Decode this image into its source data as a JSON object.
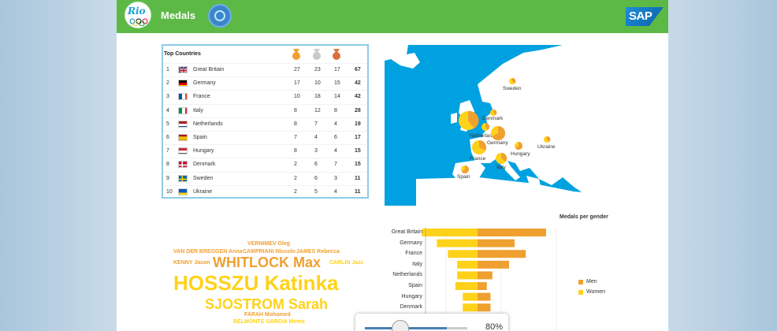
{
  "header": {
    "logo_text": "Rio",
    "title": "Medals",
    "brand": "SAP"
  },
  "table": {
    "title": "Top Countries",
    "medal_icons": [
      "gold-medal-icon",
      "silver-medal-icon",
      "bronze-medal-icon"
    ],
    "rows": [
      {
        "rank": "1",
        "country": "Great Britain",
        "flag": "uk-flag-icon",
        "gold": "27",
        "silver": "23",
        "bronze": "17",
        "total": "67"
      },
      {
        "rank": "2",
        "country": "Germany",
        "flag": "germany-flag-icon",
        "gold": "17",
        "silver": "10",
        "bronze": "15",
        "total": "42"
      },
      {
        "rank": "3",
        "country": "France",
        "flag": "france-flag-icon",
        "gold": "10",
        "silver": "18",
        "bronze": "14",
        "total": "42"
      },
      {
        "rank": "4",
        "country": "Italy",
        "flag": "italy-flag-icon",
        "gold": "8",
        "silver": "12",
        "bronze": "8",
        "total": "28"
      },
      {
        "rank": "5",
        "country": "Netherlands",
        "flag": "netherlands-flag-icon",
        "gold": "8",
        "silver": "7",
        "bronze": "4",
        "total": "19"
      },
      {
        "rank": "6",
        "country": "Spain",
        "flag": "spain-flag-icon",
        "gold": "7",
        "silver": "4",
        "bronze": "6",
        "total": "17"
      },
      {
        "rank": "7",
        "country": "Hungary",
        "flag": "hungary-flag-icon",
        "gold": "8",
        "silver": "3",
        "bronze": "4",
        "total": "15"
      },
      {
        "rank": "8",
        "country": "Denmark",
        "flag": "denmark-flag-icon",
        "gold": "2",
        "silver": "6",
        "bronze": "7",
        "total": "15"
      },
      {
        "rank": "9",
        "country": "Sweden",
        "flag": "sweden-flag-icon",
        "gold": "2",
        "silver": "6",
        "bronze": "3",
        "total": "11"
      },
      {
        "rank": "10",
        "country": "Ukraine",
        "flag": "ukraine-flag-icon",
        "gold": "2",
        "silver": "5",
        "bronze": "4",
        "total": "11"
      }
    ]
  },
  "map": {
    "labels": [
      "Sweden",
      "Denmark",
      "Netherlands",
      "Germany",
      "Ukraine",
      "Hungary",
      "France",
      "Italy",
      "Spain"
    ]
  },
  "word_cloud": [
    {
      "text": "VERNIMEV Oleg",
      "color": "#f0a030"
    },
    {
      "text": "VAN DER BREGGEN Anna",
      "color": "#f0a030"
    },
    {
      "text": "CAMPRIANI Niccolo",
      "color": "#f0a030"
    },
    {
      "text": "JAMES Rebecca",
      "color": "#f0a030"
    },
    {
      "text": "KENNY Jason",
      "color": "#f0a030"
    },
    {
      "text": "WHITLOCK Max",
      "color": "#f0a030"
    },
    {
      "text": "CARLIN Jazz",
      "color": "#ffd21a"
    },
    {
      "text": "HOSSZU Katinka",
      "color": "#ffd21a"
    },
    {
      "text": "SJOSTROM Sarah",
      "color": "#ffd21a"
    },
    {
      "text": "FARAH Mohamed",
      "color": "#f0a030"
    },
    {
      "text": "BELMONTE GARCIA Mireia",
      "color": "#ffd21a"
    }
  ],
  "chart_data": {
    "type": "bar",
    "title": "Medals per gender",
    "categories": [
      "Great Britain",
      "Germany",
      "France",
      "Italy",
      "Netherlands",
      "Spain",
      "Hungary",
      "Denmark"
    ],
    "series": [
      {
        "name": "Men",
        "color": "#f0a030",
        "values": [
          37,
          20,
          26,
          17,
          8,
          5,
          7,
          7
        ]
      },
      {
        "name": "Women",
        "color": "#ffd21a",
        "values": [
          30,
          22,
          16,
          11,
          11,
          12,
          8,
          8
        ]
      }
    ],
    "legend": "right"
  },
  "progress": {
    "label": "80%",
    "value": 0.8
  }
}
